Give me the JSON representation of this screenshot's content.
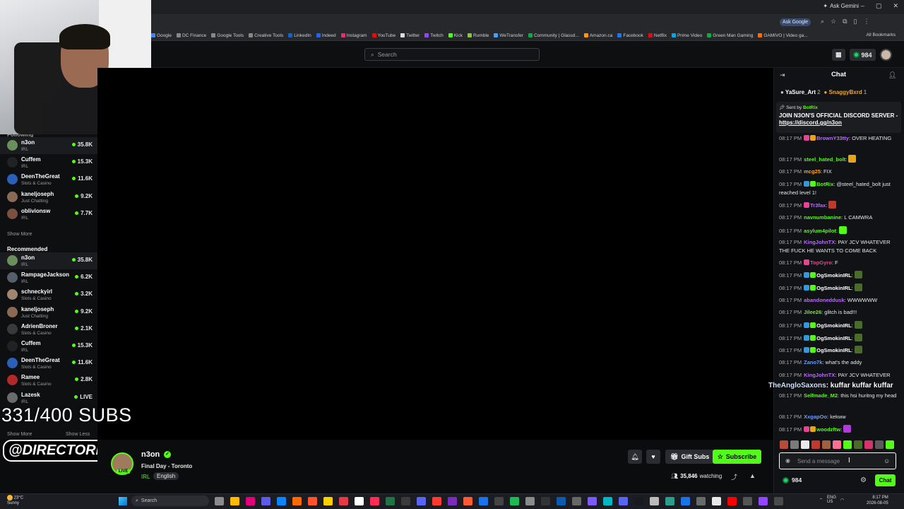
{
  "browser": {
    "gemini_label": "Ask Gemini",
    "ask_google": "Ask Google",
    "bookmarks": [
      {
        "label": "Google",
        "color": "#4285f4"
      },
      {
        "label": "DC Finance",
        "color": "#888888"
      },
      {
        "label": "Google Tools",
        "color": "#888888"
      },
      {
        "label": "Creative Tools",
        "color": "#888888"
      },
      {
        "label": "LinkedIn",
        "color": "#0a66c2"
      },
      {
        "label": "Indeed",
        "color": "#2164f3"
      },
      {
        "label": "Instagram",
        "color": "#e1306c"
      },
      {
        "label": "YouTube",
        "color": "#ff0000"
      },
      {
        "label": "Twitter",
        "color": "#dddddd"
      },
      {
        "label": "Twitch",
        "color": "#9146ff"
      },
      {
        "label": "Kick",
        "color": "#53fc18"
      },
      {
        "label": "Rumble",
        "color": "#85c742"
      },
      {
        "label": "WeTransfer",
        "color": "#409fff"
      },
      {
        "label": "Community | Glassd...",
        "color": "#0caa41"
      },
      {
        "label": "Amazon.ca",
        "color": "#ff9900"
      },
      {
        "label": "Facebook",
        "color": "#1877f2"
      },
      {
        "label": "Netflix",
        "color": "#e50914"
      },
      {
        "label": "Prime Video",
        "color": "#00a8e1"
      },
      {
        "label": "Green Man Gaming",
        "color": "#00b140"
      },
      {
        "label": "GAMIVO | Video ga...",
        "color": "#ff6b00"
      }
    ],
    "all_bookmarks": "All Bookmarks"
  },
  "site": {
    "search_placeholder": "Search",
    "balance": "984"
  },
  "overlay": {
    "subs": "331/400 SUBS",
    "handle": "@DIRECTORICY"
  },
  "sidebar": {
    "following_label": "Following",
    "following": [
      {
        "name": "n3on",
        "category": "IRL",
        "viewers": "35.8K",
        "color": "#6a8f5a",
        "active": true
      },
      {
        "name": "Cuffem",
        "category": "IRL",
        "viewers": "15.3K",
        "color": "#222222",
        "active": false
      },
      {
        "name": "DeenTheGreat",
        "category": "Slots & Casino",
        "viewers": "11.6K",
        "color": "#2b5fb8",
        "active": false
      },
      {
        "name": "kaneljoseph",
        "category": "Just Chatting",
        "viewers": "9.2K",
        "color": "#8a6a55",
        "active": false
      },
      {
        "name": "oblivionsw",
        "category": "IRL",
        "viewers": "7.7K",
        "color": "#7a5040",
        "active": false
      }
    ],
    "show_more": "Show More",
    "recommended_label": "Recommended",
    "recommended": [
      {
        "name": "n3on",
        "category": "IRL",
        "viewers": "35.8K",
        "color": "#6a8f5a",
        "active": true
      },
      {
        "name": "RampageJackson",
        "category": "IRL",
        "viewers": "6.2K",
        "color": "#555f6a",
        "active": false
      },
      {
        "name": "schneckyirl",
        "category": "Slots & Casino",
        "viewers": "3.2K",
        "color": "#a08570",
        "active": false
      },
      {
        "name": "kaneljoseph",
        "category": "Just Chatting",
        "viewers": "9.2K",
        "color": "#8a6a55",
        "active": false
      },
      {
        "name": "AdrienBroner",
        "category": "Slots & Casino",
        "viewers": "2.1K",
        "color": "#3a3a3a",
        "active": false
      },
      {
        "name": "Cuffem",
        "category": "IRL",
        "viewers": "15.3K",
        "color": "#222222",
        "active": false
      },
      {
        "name": "DeenTheGreat",
        "category": "Slots & Casino",
        "viewers": "11.6K",
        "color": "#2b5fb8",
        "active": false
      },
      {
        "name": "Ramee",
        "category": "Slots & Casino",
        "viewers": "2.8K",
        "color": "#b02a2a",
        "active": false
      },
      {
        "name": "Lazesk",
        "category": "IRL",
        "viewers": "LIVE",
        "color": "#6b6b6b",
        "active": false
      }
    ],
    "show_more_2": "Show More",
    "show_less": "Show Less"
  },
  "channel": {
    "name": "n3on",
    "live_badge": "LIVE",
    "title": "Final Day - Toronto",
    "category": "IRL",
    "language": "English",
    "gift_subs": "Gift Subs",
    "subscribe": "Subscribe",
    "watching_count": "35,846",
    "watching_label": "watching"
  },
  "chat": {
    "title": "Chat",
    "gifters": [
      {
        "name": "YaSure_Art",
        "count": "2",
        "color": "#ffffff"
      },
      {
        "name": "SnaggyBxrd",
        "count": "1",
        "color": "#f5a623"
      }
    ],
    "pinned": {
      "sent_by_label": "Sent by",
      "sender": "BotRix",
      "text": "JOIN N3ON'S OFFICIAL DISCORD SERVER - ",
      "link": "https://discord.gg/n3on"
    },
    "messages": [
      {
        "time": "08:17 PM",
        "user": "BrownY33tty",
        "color": "#b86bff",
        "text": ": OVER HEATING",
        "badges": [
          "#e84393",
          "#e8a317"
        ],
        "emote": ""
      },
      {
        "time": "08:17 PM",
        "user": "steel_hated_bolt",
        "color": "#53fc18",
        "text": ":",
        "badges": [],
        "emote": "#e8a317"
      },
      {
        "time": "08:17 PM",
        "user": "mcg25",
        "color": "#f5a623",
        "text": ": FIX",
        "badges": [],
        "emote": ""
      },
      {
        "time": "08:17 PM",
        "user": "BotRix",
        "color": "#53fc18",
        "text": ": @steel_hated_bolt just reached level 1!",
        "badges": [
          "#3498db",
          "#53fc18"
        ],
        "emote": ""
      },
      {
        "time": "08:17 PM",
        "user": "Tr3fax",
        "color": "#b86bff",
        "text": ":",
        "badges": [
          "#e84393"
        ],
        "emote": "#c0392b"
      },
      {
        "time": "08:17 PM",
        "user": "navnumbanine",
        "color": "#53fc18",
        "text": ": L CAMWRA",
        "badges": [],
        "emote": ""
      },
      {
        "time": "08:17 PM",
        "user": "asylum4pilot",
        "color": "#53fc18",
        "text": ":",
        "badges": [],
        "emote": "#53fc18"
      },
      {
        "time": "08:17 PM",
        "user": "KingJohnTX",
        "color": "#b86bff",
        "text": ": PAY JCV WHATEVER THE FUCK HE WANTS TO COME BACK",
        "badges": [],
        "emote": ""
      },
      {
        "time": "08:17 PM",
        "user": "TopGyro",
        "color": "#e84393",
        "text": ": F",
        "badges": [
          "#e84393"
        ],
        "emote": ""
      },
      {
        "time": "08:17 PM",
        "user": "OgSmokinIRL",
        "color": "#ffffff",
        "text": ":",
        "badges": [
          "#3498db",
          "#53fc18"
        ],
        "emote": "#4a6b2a"
      },
      {
        "time": "08:17 PM",
        "user": "OgSmokinIRL",
        "color": "#ffffff",
        "text": ":",
        "badges": [
          "#3498db",
          "#53fc18"
        ],
        "emote": "#4a6b2a"
      },
      {
        "time": "08:17 PM",
        "user": "abandoneddusk",
        "color": "#b86bff",
        "text": ": WWWWWW",
        "badges": [],
        "emote": ""
      },
      {
        "time": "08:17 PM",
        "user": "Jilee26",
        "color": "#53fc18",
        "text": ": glitch is bad!!!",
        "badges": [],
        "emote": ""
      },
      {
        "time": "08:17 PM",
        "user": "OgSmokinIRL",
        "color": "#ffffff",
        "text": ":",
        "badges": [
          "#3498db",
          "#53fc18"
        ],
        "emote": "#4a6b2a"
      },
      {
        "time": "08:17 PM",
        "user": "OgSmokinIRL",
        "color": "#ffffff",
        "text": ":",
        "badges": [
          "#3498db",
          "#53fc18"
        ],
        "emote": "#4a6b2a"
      },
      {
        "time": "08:17 PM",
        "user": "OgSmokinIRL",
        "color": "#ffffff",
        "text": ":",
        "badges": [
          "#3498db",
          "#53fc18"
        ],
        "emote": "#4a6b2a"
      },
      {
        "time": "08:17 PM",
        "user": "Zano7k",
        "color": "#6b9bff",
        "text": ": what's the addy",
        "badges": [],
        "emote": ""
      },
      {
        "time": "08:17 PM",
        "user": "KingJohnTX",
        "color": "#b86bff",
        "text": ": PAY JCV WHATEVER",
        "badges": [],
        "emote": ""
      },
      {
        "time": "08:17 PM",
        "user": "Selfmade_M2",
        "color": "#53fc18",
        "text": ": this hsi huritng my head",
        "badges": [],
        "emote": ""
      },
      {
        "time": "08:17 PM",
        "user": "XxgapOo",
        "color": "#6b9bff",
        "text": ": kekww",
        "badges": [],
        "emote": ""
      },
      {
        "time": "08:17 PM",
        "user": "woodzftw",
        "color": "#53fc18",
        "text": ":",
        "badges": [
          "#e84393",
          "#e8a317"
        ],
        "emote": "#b03bd6"
      }
    ],
    "tts_name": "TheAngloSaxons",
    "tts_text": ": kuffar kuffar kuffar",
    "input_placeholder": "Send a message",
    "balance": "984",
    "send": "Chat"
  },
  "taskbar": {
    "temp": "23°C",
    "weather": "Sunny",
    "search": "Search",
    "lang": "ENG",
    "region": "US",
    "time": "8:17 PM",
    "date": "2026-08-05"
  }
}
